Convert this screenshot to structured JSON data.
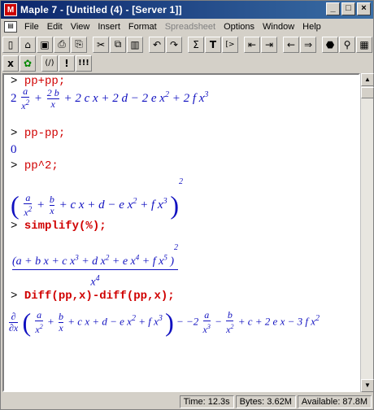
{
  "window": {
    "title": "Maple 7 - [Untitled (4) - [Server 1]]",
    "app_icon": "maple-icon"
  },
  "menu": {
    "items": [
      "File",
      "Edit",
      "View",
      "Insert",
      "Format",
      "Spreadsheet",
      "Options",
      "Window",
      "Help"
    ],
    "disabled": [
      "Spreadsheet"
    ]
  },
  "toolbar1": {
    "buttons": [
      "new-icon",
      "open-icon",
      "save-icon",
      "print-icon",
      "print-preview-icon",
      "cut-icon",
      "copy-icon",
      "paste-icon",
      "undo-icon",
      "redo-icon",
      "sigma",
      "T",
      "[>",
      "indent-left-icon",
      "indent-right-icon",
      "back-arrow-icon",
      "forward-arrow-icon",
      "stop-icon",
      "zoom-icon",
      "restart-icon"
    ],
    "labels": {
      "sigma": "Σ",
      "T": "T",
      "prompt": "[>"
    }
  },
  "toolbar2": {
    "buttons": [
      "x",
      "!",
      "(/)",
      "!",
      "!!!"
    ]
  },
  "worksheet": {
    "cmd1": "pp+pp;",
    "out1": {
      "coef": "2",
      "t1": "a",
      "t1d": "x",
      "t1e": "2",
      "t2n": "2 b",
      "t2d": "x",
      "rest": "+ 2 c x + 2 d − 2 e x",
      "e2": "2",
      "tail": "+ 2 f x",
      "e3": "3"
    },
    "cmd2": "pp-pp;",
    "out2": "0",
    "cmd3": "pp^2;",
    "out3": {
      "an": "a",
      "ad": "x",
      "ae": "2",
      "bn": "b",
      "bd": "x",
      "rest": "+ c x + d − e x",
      "e2": "2",
      "tail": "+ f x",
      "e3": "3",
      "pow": "2"
    },
    "cmd4": "simplify(%);",
    "out4": {
      "num": "(a + b x + c x",
      "n3": "3",
      "num2": "+ d x",
      "n2": "2",
      "num3": "+ e x",
      "n4": "4",
      "num4": "+ f x",
      "n5": "5",
      "num5": ")",
      "pow": "2",
      "den": "x",
      "denp": "4"
    },
    "cmd5": "Diff(pp,x)-diff(pp,x);",
    "out5": {
      "dn": "∂",
      "dd": "∂x",
      "an": "a",
      "ad": "x",
      "ae": "2",
      "bn": "b",
      "bd": "x",
      "rest": "+ c x + d − e x",
      "e2": "2",
      "tail": "+ f x",
      "e3": "3",
      "after": "− −2",
      "f1n": "a",
      "f1d": "x",
      "f1e": "3",
      "f2n": "b",
      "f2d": "x",
      "f2e": "2",
      "end": "+ c + 2 e x − 3 f x",
      "ende": "2"
    }
  },
  "status": {
    "time": "Time: 12.3s",
    "bytes": "Bytes: 3.62M",
    "available": "Available: 87.8M"
  }
}
